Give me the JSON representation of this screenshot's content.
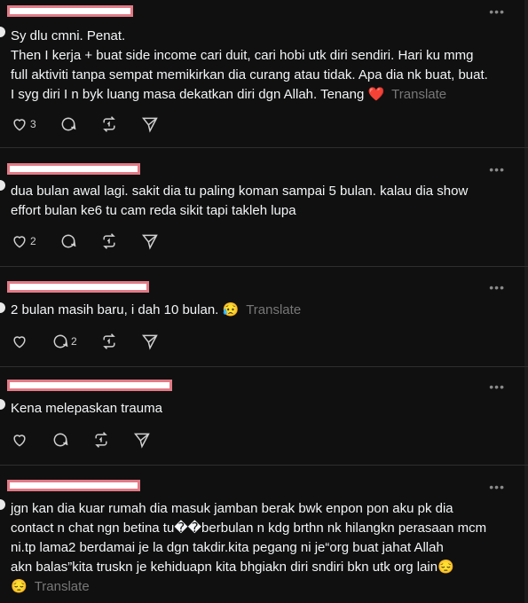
{
  "icons": {
    "like": "heart-icon",
    "reply": "comment-bubble-icon",
    "repost": "repost-icon",
    "share": "send-icon",
    "more": "more-icon"
  },
  "ui": {
    "more_label": "•••",
    "translate_label": "Translate"
  },
  "posts": [
    {
      "text_lines": [
        "Sy dlu cmni. Penat.",
        "Then I kerja + buat side income cari duit, cari hobi utk diri sendiri. Hari ku mmg",
        "full aktiviti tanpa sempat memikirkan dia curang atau tidak. Apa dia nk buat, buat.",
        "I syg diri I n byk luang masa dekatkan diri dgn Allah. Tenang ❤️"
      ],
      "show_translate": true,
      "likes": "3",
      "replies": ""
    },
    {
      "text_lines": [
        "dua bulan awal lagi. sakit dia tu paling koman sampai 5 bulan. kalau dia show",
        "effort bulan ke6 tu cam reda sikit tapi takleh lupa"
      ],
      "show_translate": false,
      "likes": "2",
      "replies": ""
    },
    {
      "text_lines": [
        "2 bulan masih baru, i dah 10 bulan. 😥"
      ],
      "show_translate": true,
      "likes": "",
      "replies": "2"
    },
    {
      "text_lines": [
        "Kena melepaskan trauma"
      ],
      "show_translate": false,
      "likes": "",
      "replies": ""
    },
    {
      "text_lines": [
        "jgn kan dia kuar rumah dia masuk jamban berak bwk enpon pon aku pk dia",
        "contact n chat ngn betina tu��berbulan n kdg brthn nk hilangkn perasaan mcm",
        "ni.tp lama2 berdamai je la dgn takdir.kita pegang ni je“org buat jahat Allah",
        "akn balas”kita truskn je kehiduapn kita bhgiakn diri sndiri bkn utk org lain😔",
        "😔"
      ],
      "show_translate": true,
      "likes": "",
      "replies": ""
    }
  ]
}
